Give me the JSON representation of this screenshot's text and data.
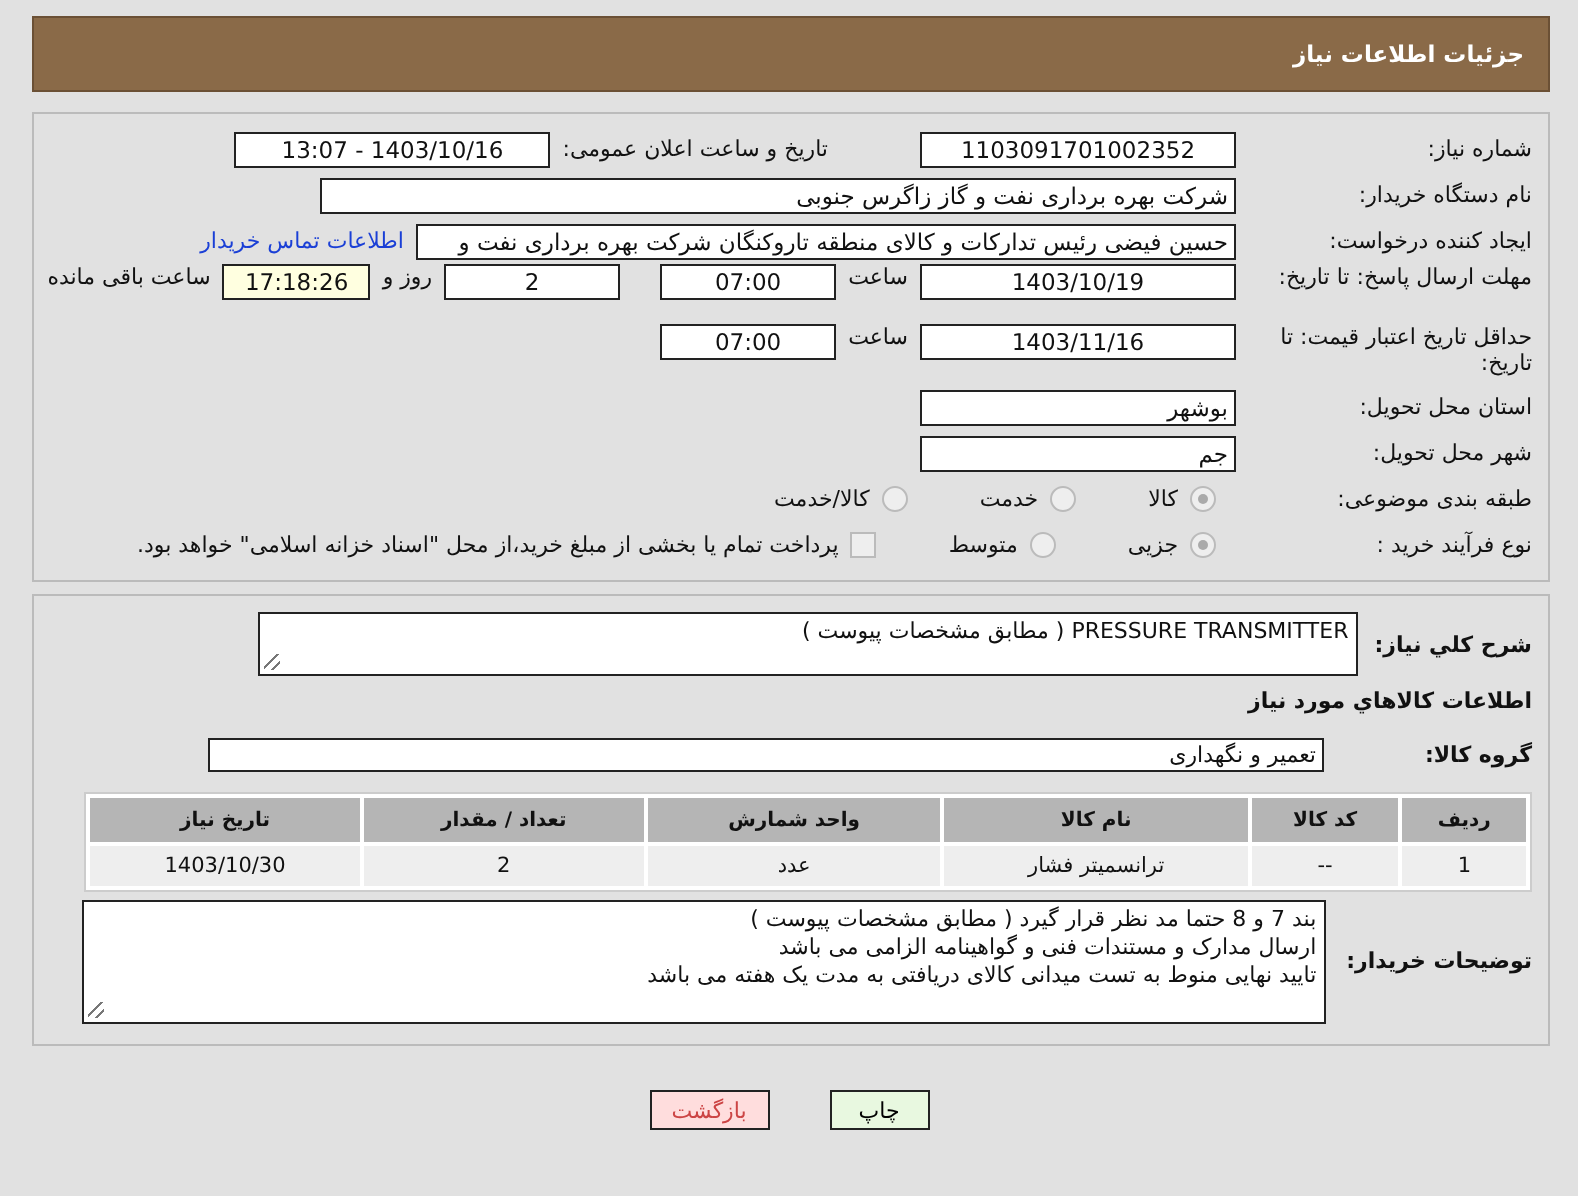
{
  "header": {
    "title": "جزئیات اطلاعات نیاز"
  },
  "form": {
    "need_number": {
      "label": "شماره نیاز:",
      "value": "1103091701002352"
    },
    "announce": {
      "label": "تاریخ و ساعت اعلان عمومی:",
      "value": "1403/10/16 - 13:07"
    },
    "buyer": {
      "label": "نام دستگاه خریدار:",
      "value": "شرکت بهره برداری نفت و گاز زاگرس جنوبی"
    },
    "creator": {
      "label": "ایجاد کننده درخواست:",
      "value": "حسین فیضی رئیس تدارکات و کالای منطقه تاروکنگان شرکت بهره برداری نفت و",
      "link": "اطلاعات تماس خریدار"
    },
    "deadline": {
      "label": "مهلت ارسال پاسخ: تا تاریخ:",
      "date": "1403/10/19",
      "time_label": "ساعت",
      "time": "07:00",
      "days": "2",
      "days_label": "روز و",
      "remaining": "17:18:26",
      "remaining_label": "ساعت باقی مانده"
    },
    "validity": {
      "label": "حداقل تاریخ اعتبار قیمت: تا تاریخ:",
      "date": "1403/11/16",
      "time_label": "ساعت",
      "time": "07:00"
    },
    "province": {
      "label": "استان محل تحویل:",
      "value": "بوشهر"
    },
    "city": {
      "label": "شهر محل تحویل:",
      "value": "جم"
    },
    "category": {
      "label": "طبقه بندی موضوعی:",
      "options": [
        {
          "label": "کالا",
          "selected": true
        },
        {
          "label": "خدمت",
          "selected": false
        },
        {
          "label": "کالا/خدمت",
          "selected": false
        }
      ]
    },
    "process": {
      "label": "نوع فرآیند خرید :",
      "options": [
        {
          "label": "جزیی",
          "selected": true
        },
        {
          "label": "متوسط",
          "selected": false
        }
      ],
      "payment": {
        "label": "پرداخت تمام یا بخشی از مبلغ خرید،از محل \"اسناد خزانه اسلامی\" خواهد بود.",
        "checked": false
      }
    }
  },
  "details": {
    "summary": {
      "label": "شرح کلي نياز:",
      "value": "PRESSURE  TRANSMITTER ( مطابق مشخصات پیوست  )"
    },
    "goods_heading": "اطلاعات کالاهاي مورد نياز",
    "group": {
      "label": "گروه کالا:",
      "value": "تعمیر و نگهداری"
    },
    "table": {
      "columns": [
        "ردیف",
        "کد کالا",
        "نام کالا",
        "واحد شمارش",
        "تعداد / مقدار",
        "تاریخ نیاز"
      ],
      "rows": [
        [
          "1",
          "--",
          "ترانسمیتر فشار",
          "عدد",
          "2",
          "1403/10/30"
        ]
      ]
    },
    "notes": {
      "label": "توضیحات خریدار:",
      "lines": [
        "بند  7   و 8  حتما مد نظر قرار گیرد  ( مطابق مشخصات پیوست )",
        "ارسال مدارک و مستندات فنی و گواهینامه الزامی می باشد",
        "تایید نهایی منوط به تست میدانی کالای دریافتی به مدت یک هفته می باشد"
      ]
    }
  },
  "buttons": [
    {
      "label": "چاپ",
      "kind": "print"
    },
    {
      "label": "بازگشت",
      "kind": "back"
    }
  ]
}
